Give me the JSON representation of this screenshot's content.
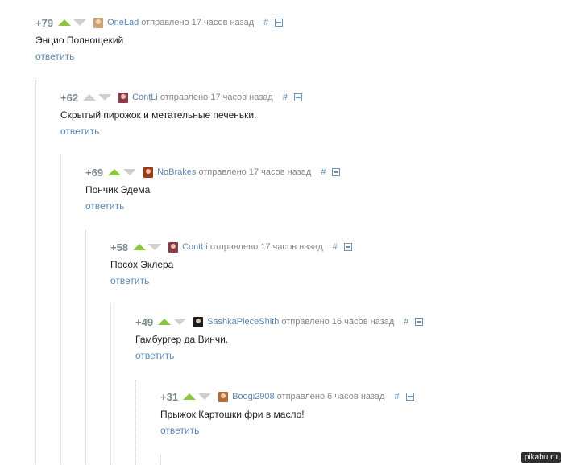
{
  "comments": [
    {
      "rating": "+79",
      "user": "OneLad",
      "sent": "отправлено 17 часов назад",
      "text": "Энцио Полнощекий",
      "reply": "ответить",
      "avatar_color": "#c9a27a"
    },
    {
      "rating": "+62",
      "user": "ContLi",
      "sent": "отправлено 17 часов назад",
      "text": "Скрытый пирожок и метательные печеньки.",
      "reply": "ответить",
      "avatar_color": "#8b3a4a"
    },
    {
      "rating": "+69",
      "user": "NoBrakes",
      "sent": "отправлено 17 часов назад",
      "text": "Пончик Эдема",
      "reply": "ответить",
      "avatar_color": "#9a3b1e"
    },
    {
      "rating": "+58",
      "user": "ContLi",
      "sent": "отправлено 17 часов назад",
      "text": "Посох Эклера",
      "reply": "ответить",
      "avatar_color": "#8b3a4a"
    },
    {
      "rating": "+49",
      "user": "SashkaPieceShith",
      "sent": "отправлено 16 часов назад",
      "text": "Гамбургер да Винчи.",
      "reply": "ответить",
      "avatar_color": "#1d1d1d"
    },
    {
      "rating": "+31",
      "user": "Boogi2908",
      "sent": "отправлено 6 часов назад",
      "text": "Прыжок Картошки фри в масло!",
      "reply": "ответить",
      "avatar_color": "#b06a3c"
    }
  ],
  "permalink": "#",
  "watermark": "pikabu.ru",
  "colors": {
    "vote_up": "#8cc63e",
    "vote_down": "#cfcfcf",
    "link": "#5b89b5",
    "meta": "#888888"
  }
}
